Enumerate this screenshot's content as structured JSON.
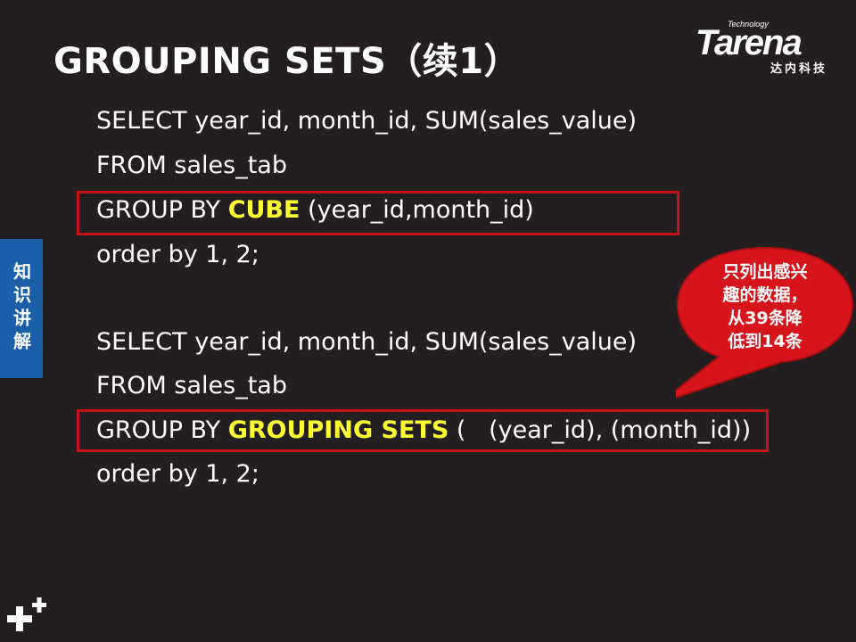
{
  "slide": {
    "title": "GROUPING SETS（续1）",
    "side_tab": "知识讲解",
    "logo": {
      "tech": "Technology",
      "word": "Tarena",
      "sub": "达内科技"
    }
  },
  "query1": {
    "line1": "SELECT year_id, month_id, SUM(sales_value)",
    "line2": "FROM sales_tab",
    "line3_pre": "GROUP BY ",
    "line3_kw": "CUBE",
    "line3_post": " (year_id,month_id)",
    "line4": "order by 1, 2;"
  },
  "query2": {
    "line1": "SELECT year_id, month_id, SUM(sales_value)",
    "line2": "FROM sales_tab",
    "line3_pre": "GROUP BY ",
    "line3_kw": "GROUPING SETS",
    "line3_post": " (   (year_id), (month_id))",
    "line4": "order by 1, 2;"
  },
  "callout": {
    "line1": "只列出感兴",
    "line2": "趣的数据，",
    "line3": "从39条降",
    "line4": "低到14条",
    "color": "#d7141b"
  },
  "colors": {
    "background": "#231f20",
    "keyword": "#ffff33",
    "box": "#c4121a",
    "side_tab": "#1a5fa8"
  },
  "icons": {
    "corner": "plus-plus-icon"
  }
}
